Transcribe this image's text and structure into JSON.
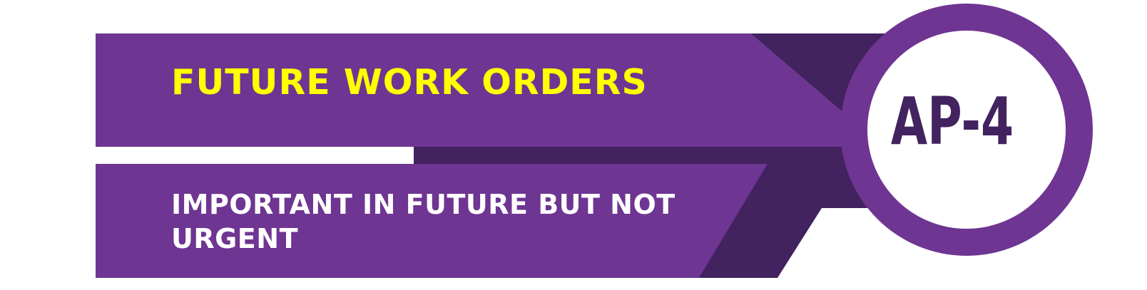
{
  "banner": {
    "title": "FUTURE WORK ORDERS",
    "subtitle": "IMPORTANT IN FUTURE BUT NOT URGENT",
    "badge": "AP-4"
  },
  "colors": {
    "purple": "#6e3592",
    "dark_purple": "#42225f",
    "yellow": "#ffff00",
    "white": "#ffffff"
  }
}
